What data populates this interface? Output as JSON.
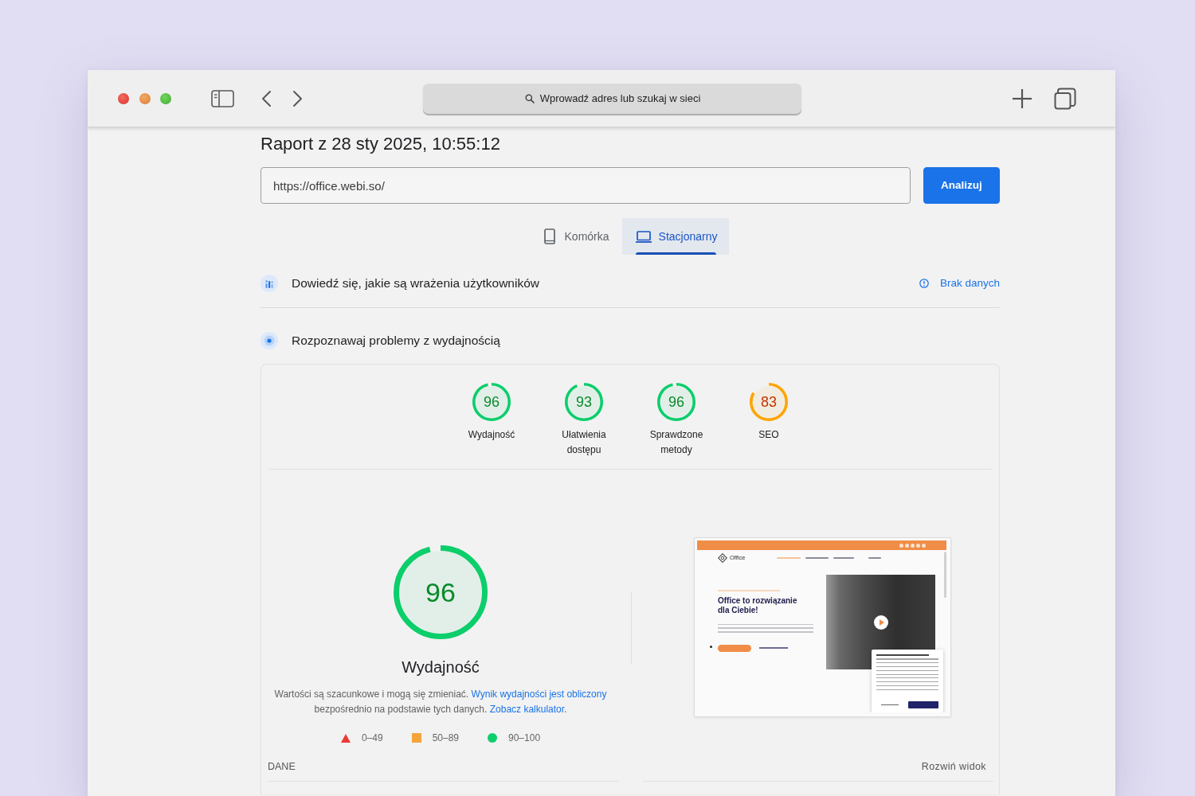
{
  "browser": {
    "address_placeholder": "Wprowadź adres lub szukaj w sieci"
  },
  "report": {
    "title": "Raport z 28 sty 2025, 10:55:12",
    "url": "https://office.webi.so/",
    "analyze_button": "Analizuj"
  },
  "device_tabs": [
    {
      "kind": "mobile",
      "label": "Komórka",
      "selected": false
    },
    {
      "kind": "desktop",
      "label": "Stacjonarny",
      "selected": true
    }
  ],
  "sections": [
    {
      "kind": "field",
      "title": "Dowiedź się, jakie są wrażenia użytkowników",
      "status": "Brak danych"
    },
    {
      "kind": "lab",
      "title": "Rozpoznawaj problemy z wydajnością"
    }
  ],
  "categories": [
    {
      "score": "96",
      "label": "Wydajność"
    },
    {
      "score": "93",
      "label": "Ułatwienia dostępu"
    },
    {
      "score": "96",
      "label": "Sprawdzone metody"
    },
    {
      "score": "83",
      "label": "SEO"
    }
  ],
  "performance": {
    "score": "96",
    "title": "Wydajność",
    "description": [
      {
        "kind": "text",
        "text": "Wartości są szacunkowe i mogą się zmieniać. "
      },
      {
        "kind": "link",
        "text": "Wynik wydajności jest obliczony"
      },
      {
        "kind": "text",
        "text": " bezpośrednio na podstawie tych danych. "
      },
      {
        "kind": "link",
        "text": "Zobacz kalkulator"
      },
      {
        "kind": "text",
        "text": "."
      }
    ],
    "legend": [
      {
        "kind": "fail",
        "range": "0–49"
      },
      {
        "kind": "average",
        "range": "50–89"
      },
      {
        "kind": "pass",
        "range": "90–100"
      }
    ],
    "screenshot": {
      "logo": "Office",
      "headline": "Office to rozwiązanie dla Ciebie!"
    }
  },
  "data_header": {
    "title": "DANE",
    "expand_link": "Rozwiń widok"
  }
}
